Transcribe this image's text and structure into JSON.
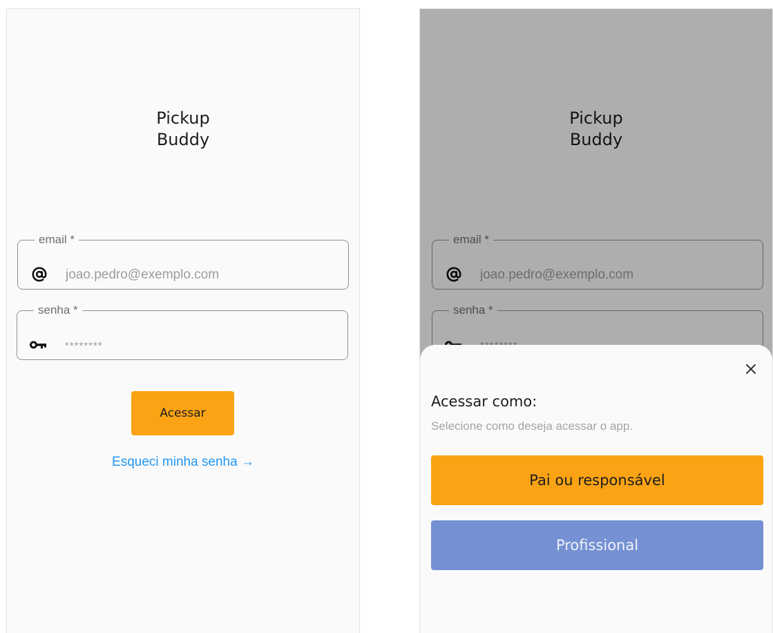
{
  "app": {
    "title_line1": "Pickup",
    "title_line2": "Buddy"
  },
  "login": {
    "email": {
      "label": "email *",
      "placeholder": "joao.pedro@exemplo.com",
      "icon": "at-icon"
    },
    "password": {
      "label": "senha *",
      "placeholder": "********",
      "icon": "key-icon"
    },
    "submit_label": "Acessar",
    "forgot_label": "Esqueci minha senha →"
  },
  "access_sheet": {
    "title": "Acessar como:",
    "subtitle": "Selecione como deseja acessar o app.",
    "parent_label": "Pai ou responsável",
    "professional_label": "Profissional",
    "close_icon": "close-icon"
  },
  "colors": {
    "accent": "#fba314",
    "link": "#2196f3",
    "secondary": "#7591d3",
    "background": "#fafafa"
  }
}
